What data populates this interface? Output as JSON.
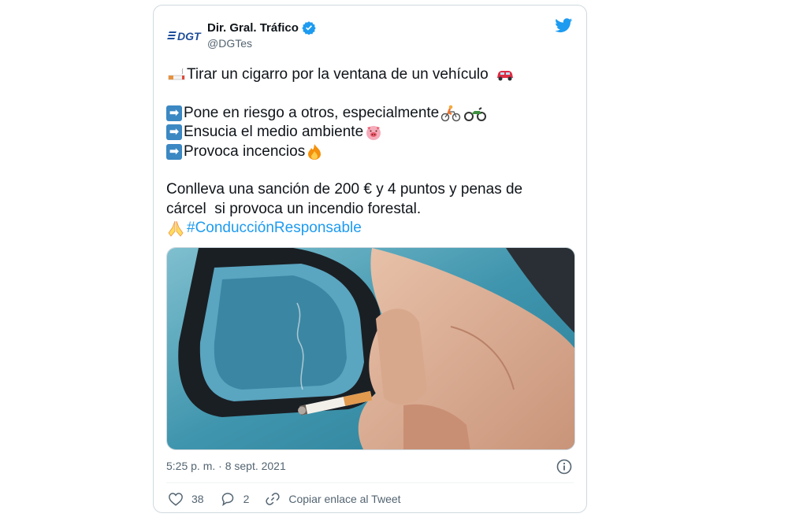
{
  "tweet": {
    "author_name": "Dir. Gral. Tráfico",
    "handle": "@DGTes",
    "logo_text": "DGT",
    "lines": {
      "l1": "Tirar un cigarro por la ventana de un vehículo",
      "l2": "Pone en riesgo a otros, especialmente",
      "l3": "Ensucia el medio ambiente",
      "l4": "Provoca incencios",
      "l5": "Conlleva una sanción de 200 € y 4 puntos y penas de",
      "l6": "cárcel  si provoca un incendio forestal.",
      "hashtag": "#ConducciónResponsable"
    },
    "timestamp": "5:25 p. m. · 8 sept. 2021",
    "likes": "38",
    "replies": "2",
    "copy_link": "Copiar enlace al Tweet"
  },
  "colors": {
    "accent": "#1d9bf0",
    "verified": "#1d9bf0",
    "text": "#0f1419",
    "secondary": "#536471"
  },
  "icons": [
    "dgt-logo-icon",
    "verified-badge-icon",
    "twitter-bird-icon",
    "arrow-right-icon",
    "info-icon",
    "heart-icon",
    "reply-icon",
    "link-icon"
  ]
}
